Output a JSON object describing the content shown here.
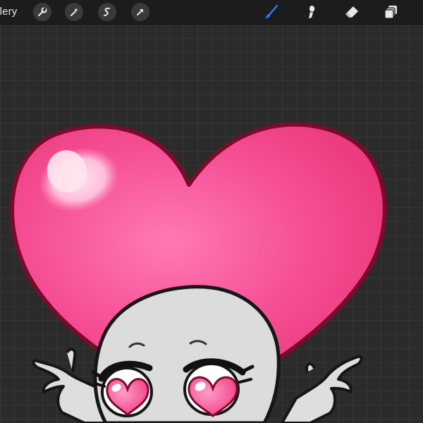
{
  "toolbar": {
    "gallery_label": "llery",
    "left_tools": [
      "wrench-icon",
      "magic-wand-icon",
      "selection-icon",
      "transform-arrow-icon"
    ],
    "right_tools": [
      "brush-icon",
      "smudge-icon",
      "eraser-icon",
      "layers-icon"
    ],
    "active_tool": "brush-icon",
    "active_color": "#2f7bff"
  },
  "canvas": {
    "grid": true,
    "artwork": [
      "pink-heart",
      "chibi-character-with-heart-eyes"
    ],
    "heart_color": "#f2468c",
    "outline_color": "#7a0b2a"
  }
}
